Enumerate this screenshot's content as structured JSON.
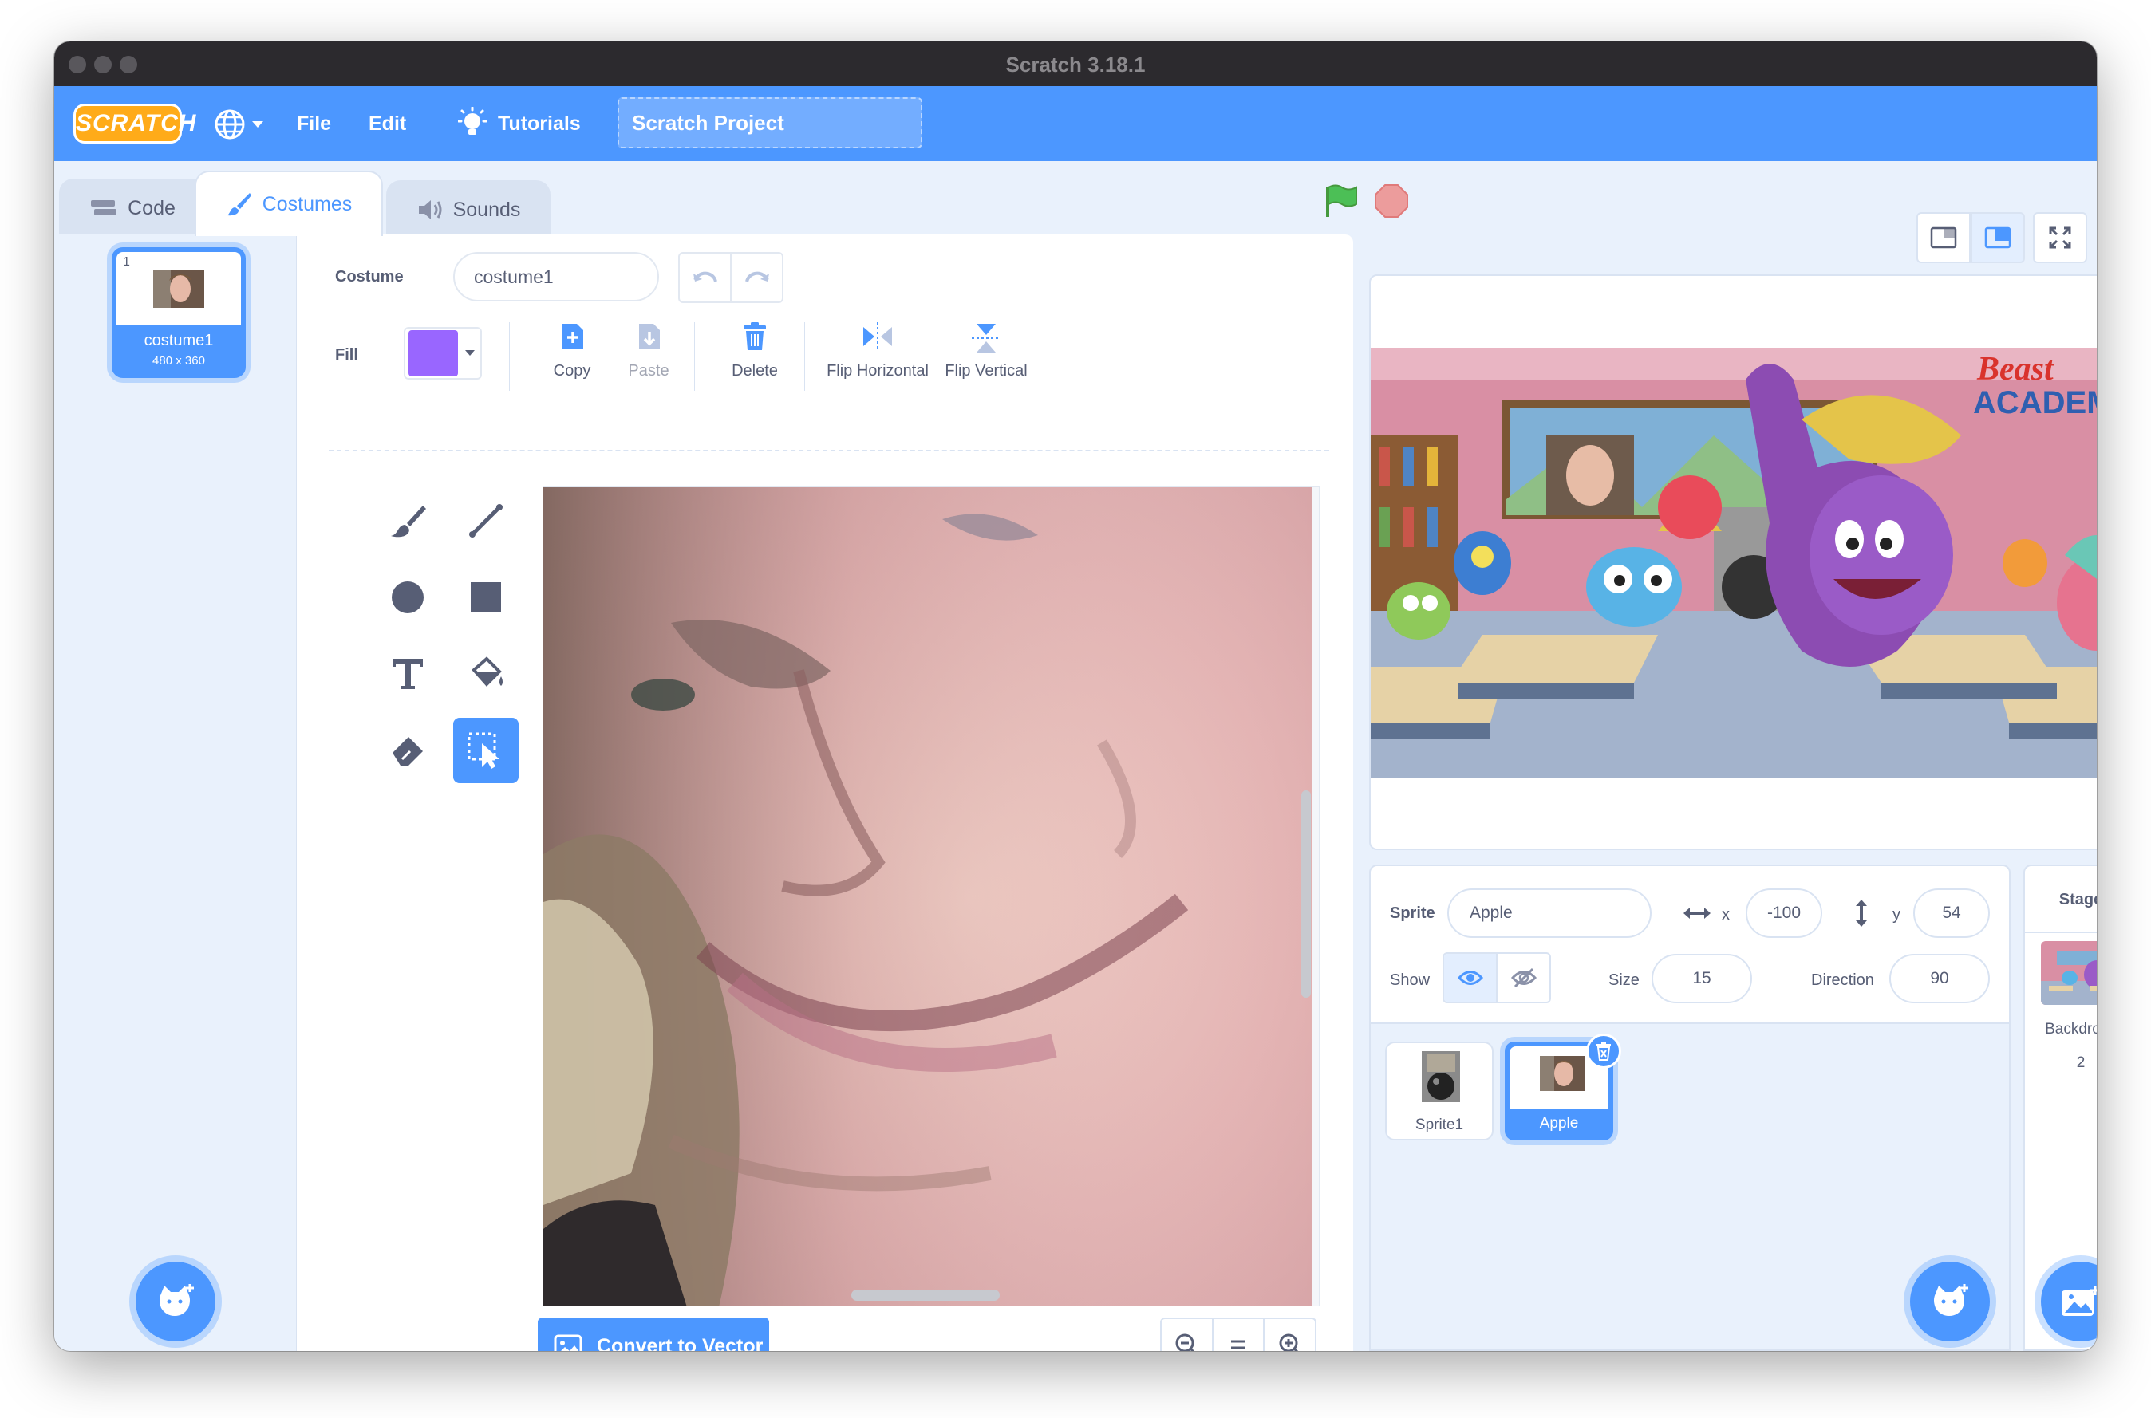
{
  "window": {
    "title": "Scratch 3.18.1"
  },
  "menubar": {
    "logo": "SCRATCH",
    "file": "File",
    "edit": "Edit",
    "tutorials": "Tutorials",
    "project_title": "Scratch Project"
  },
  "tabs": [
    {
      "label": "Code",
      "icon": "code-icon"
    },
    {
      "label": "Costumes",
      "icon": "paintbrush-icon",
      "active": true
    },
    {
      "label": "Sounds",
      "icon": "speaker-icon"
    }
  ],
  "costume_list": [
    {
      "number": "1",
      "name": "costume1",
      "size": "480 x 360"
    }
  ],
  "paint_editor": {
    "costume_label": "Costume",
    "costume_name": "costume1",
    "fill_label": "Fill",
    "fill_color": "#9966ff",
    "actions": {
      "copy": "Copy",
      "paste": "Paste",
      "delete": "Delete",
      "flip_horizontal": "Flip Horizontal",
      "flip_vertical": "Flip Vertical"
    },
    "tools": [
      "brush-icon",
      "line-icon",
      "circle-icon",
      "rectangle-icon",
      "text-icon",
      "fill-icon",
      "eraser-icon",
      "select-icon"
    ],
    "active_tool": "select-icon",
    "convert_button": "Convert to Vector",
    "zoom": {
      "zoom_out": "−",
      "reset": "=",
      "zoom_in": "+"
    }
  },
  "stage": {
    "logo_line1": "Beast",
    "logo_line2": "ACADEMY"
  },
  "sprite_info": {
    "sprite_label": "Sprite",
    "sprite_name": "Apple",
    "x_label": "x",
    "x_value": "-100",
    "y_label": "y",
    "y_value": "54",
    "show_label": "Show",
    "size_label": "Size",
    "size_value": "15",
    "direction_label": "Direction",
    "direction_value": "90"
  },
  "sprites": [
    {
      "name": "Sprite1",
      "selected": false
    },
    {
      "name": "Apple",
      "selected": true
    }
  ],
  "stage_panel": {
    "title": "Stage",
    "backdrops_label": "Backdrops",
    "backdrops_count": "2"
  },
  "colors": {
    "accent": "#4c97ff",
    "background": "#e9f1fc",
    "text": "#575e75",
    "stop": "#ec9c9c",
    "flag": "#4cbf56"
  }
}
